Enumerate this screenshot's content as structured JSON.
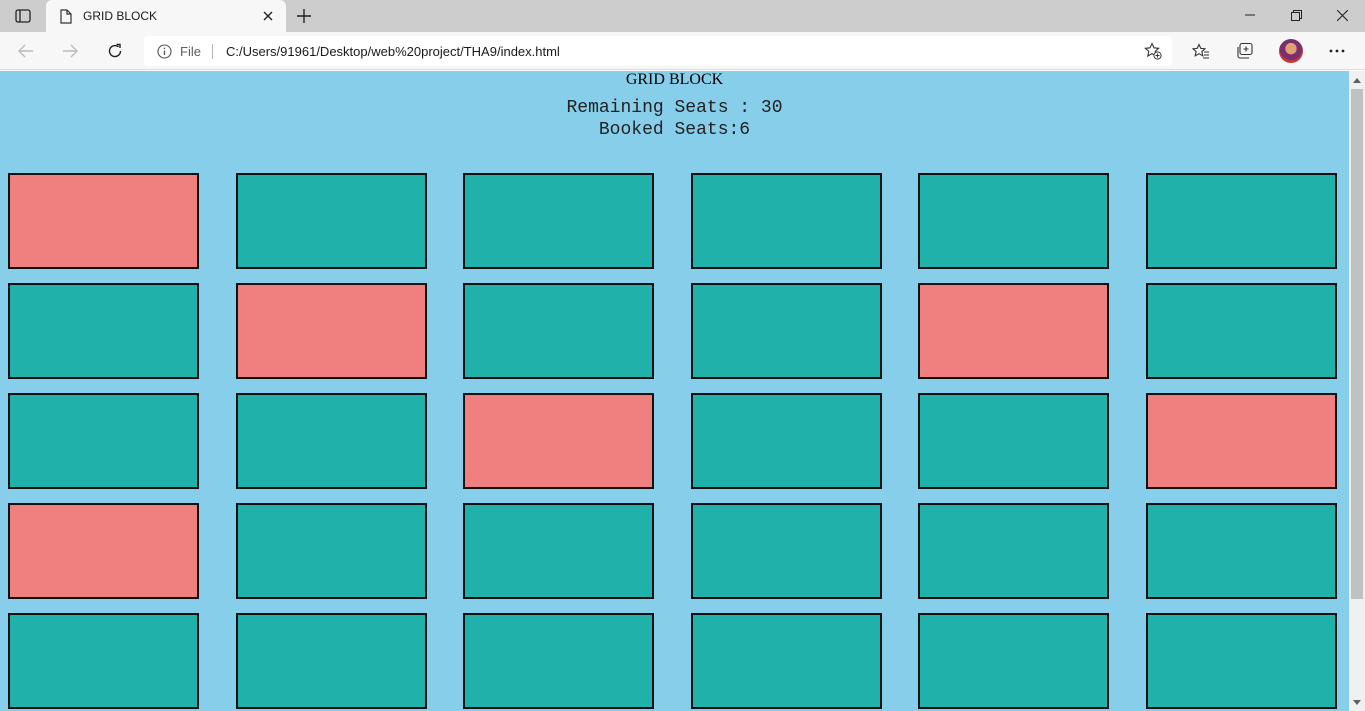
{
  "browser": {
    "tab": {
      "title": "GRID BLOCK"
    },
    "address_bar": {
      "scheme_label": "File",
      "url": "C:/Users/91961/Desktop/web%20project/THA9/index.html"
    },
    "icons": {
      "tab_actions": "tab-actions-icon",
      "favicon": "file-icon",
      "tab_close": "close-icon",
      "new_tab": "plus-icon",
      "back": "back-arrow-icon",
      "forward": "forward-arrow-icon",
      "refresh": "refresh-icon",
      "info": "info-icon",
      "add_favorite": "star-plus-icon",
      "favorites": "favorites-icon",
      "collections": "collections-icon",
      "profile": "avatar",
      "more": "more-icon",
      "minimize": "minimize-icon",
      "maximize": "restore-icon",
      "close_window": "close-icon"
    }
  },
  "page": {
    "heading": "GRID BLOCK",
    "remaining_text": "Remaining Seats : 30",
    "booked_text": "Booked Seats:6",
    "colors": {
      "background": "#87ceeb",
      "available": "#20b2aa",
      "booked": "#f08080"
    },
    "seats": [
      "booked",
      "available",
      "available",
      "available",
      "available",
      "available",
      "available",
      "booked",
      "available",
      "available",
      "booked",
      "available",
      "available",
      "available",
      "booked",
      "available",
      "available",
      "booked",
      "booked",
      "available",
      "available",
      "available",
      "available",
      "available",
      "available",
      "available",
      "available",
      "available",
      "available",
      "available"
    ]
  }
}
